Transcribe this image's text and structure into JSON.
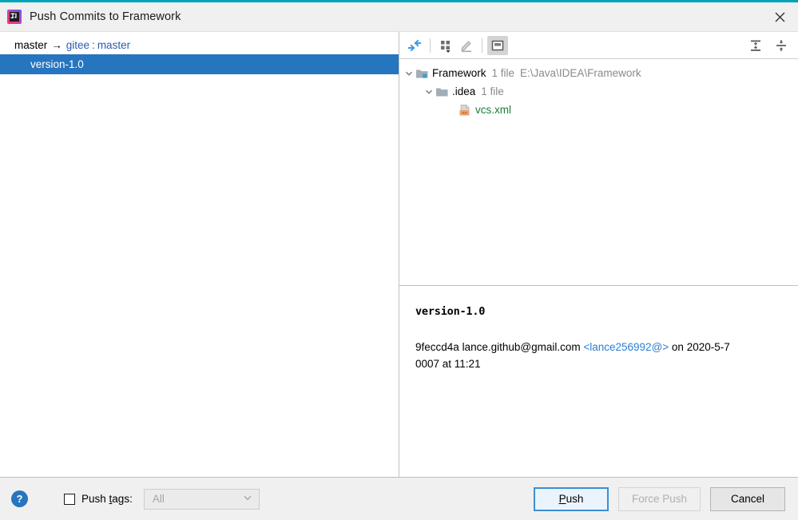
{
  "window": {
    "title": "Push Commits to Framework",
    "app_icon": "intellij-idea-logo",
    "close_icon": "close-icon",
    "accent_color": "#00a3b5"
  },
  "commit_list": {
    "repo_row": {
      "source_branch": "master",
      "arrow": "→",
      "remote": "gitee",
      "separator": ":",
      "target_branch": "master"
    },
    "commits": [
      {
        "subject": "version-1.0",
        "selected": true
      }
    ],
    "selection_color": "#2675bf"
  },
  "toolbar": {
    "left_buttons": [
      {
        "name": "collapse-arrows-icon",
        "label": "Expand or collapse",
        "pressed": false
      },
      {
        "name": "group-by-icon",
        "label": "Group By",
        "pressed": false
      },
      {
        "name": "edit-pencil-icon",
        "label": "Edit Source",
        "pressed": false,
        "disabled": true
      },
      {
        "name": "preview-diff-icon",
        "label": "Preview Diff",
        "pressed": true
      }
    ],
    "right_buttons": [
      {
        "name": "expand-all-icon",
        "label": "Expand All"
      },
      {
        "name": "collapse-all-icon",
        "label": "Collapse All"
      }
    ]
  },
  "file_tree": {
    "nodes": [
      {
        "level": 0,
        "chevron": "chevron-down-icon",
        "icon": "module-folder-icon",
        "label": "Framework",
        "label_color": "black",
        "meta": "1 file",
        "path": "E:\\Java\\IDEA\\Framework"
      },
      {
        "level": 1,
        "chevron": "chevron-down-icon",
        "icon": "folder-icon",
        "label": ".idea",
        "label_color": "black",
        "meta": "1 file",
        "path": ""
      },
      {
        "level": 2,
        "chevron": "",
        "icon": "xml-file-icon",
        "label": "vcs.xml",
        "label_color": "green",
        "meta": "",
        "path": ""
      }
    ]
  },
  "commit_details": {
    "subject": "version-1.0",
    "hash": "9feccd4a",
    "author_email": "lance.github@gmail.com",
    "author_handle": "<lance256992@>",
    "on_word": "on",
    "date_line": "2020-5-7 0007 at 11:21"
  },
  "footer": {
    "help_icon": "help-icon",
    "help_glyph": "?",
    "push_tags": {
      "checked": false,
      "label_prefix": "Push ",
      "label_mnemonic": "t",
      "label_suffix": "ags:",
      "combo_value": "All",
      "combo_enabled": false,
      "combo_chevron": "chevron-down-icon"
    },
    "buttons": [
      {
        "name": "push-button",
        "mnemonic": "P",
        "rest": "ush",
        "style": "default",
        "enabled": true
      },
      {
        "name": "force-push-button",
        "label": "Force Push",
        "style": "disabled",
        "enabled": false
      },
      {
        "name": "cancel-button",
        "label": "Cancel",
        "style": "normal",
        "enabled": true
      }
    ]
  }
}
